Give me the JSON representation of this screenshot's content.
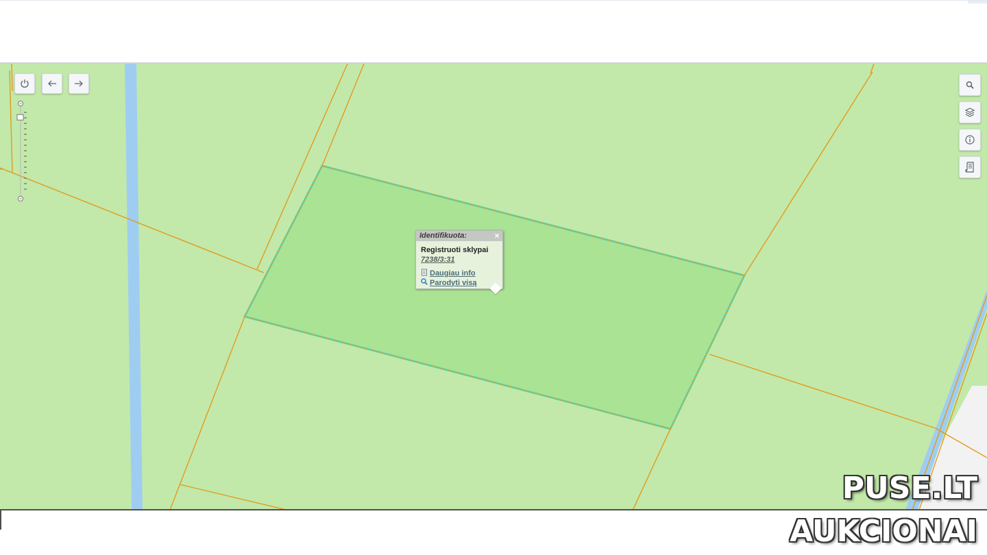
{
  "map": {
    "colors": {
      "land": "#c2e9aa",
      "parcel_border": "#e39a1c",
      "selected_fill": "#aae394",
      "selected_outline": "#40e6d0",
      "water": "#9fcdf1",
      "road": "#f2f2f2"
    },
    "selected_parcel": "7238/3:31"
  },
  "controls": {
    "left": [
      {
        "name": "power-icon"
      },
      {
        "name": "arrow-left-icon"
      },
      {
        "name": "arrow-right-icon"
      }
    ],
    "right": [
      {
        "name": "search-icon"
      },
      {
        "name": "layers-icon"
      },
      {
        "name": "info-icon"
      },
      {
        "name": "document-icon"
      }
    ],
    "zoom": {
      "level_fraction": 0.1
    }
  },
  "popup": {
    "title": "Identifikuota:",
    "close": "×",
    "layer": "Registruoti sklypai",
    "parcel_id": "7238/3:31",
    "more_info": "Daugiau info",
    "show_all": "Parodyti visą"
  },
  "watermark": {
    "line1": "PUSE.LT",
    "line2": "AUKCIONAI"
  }
}
